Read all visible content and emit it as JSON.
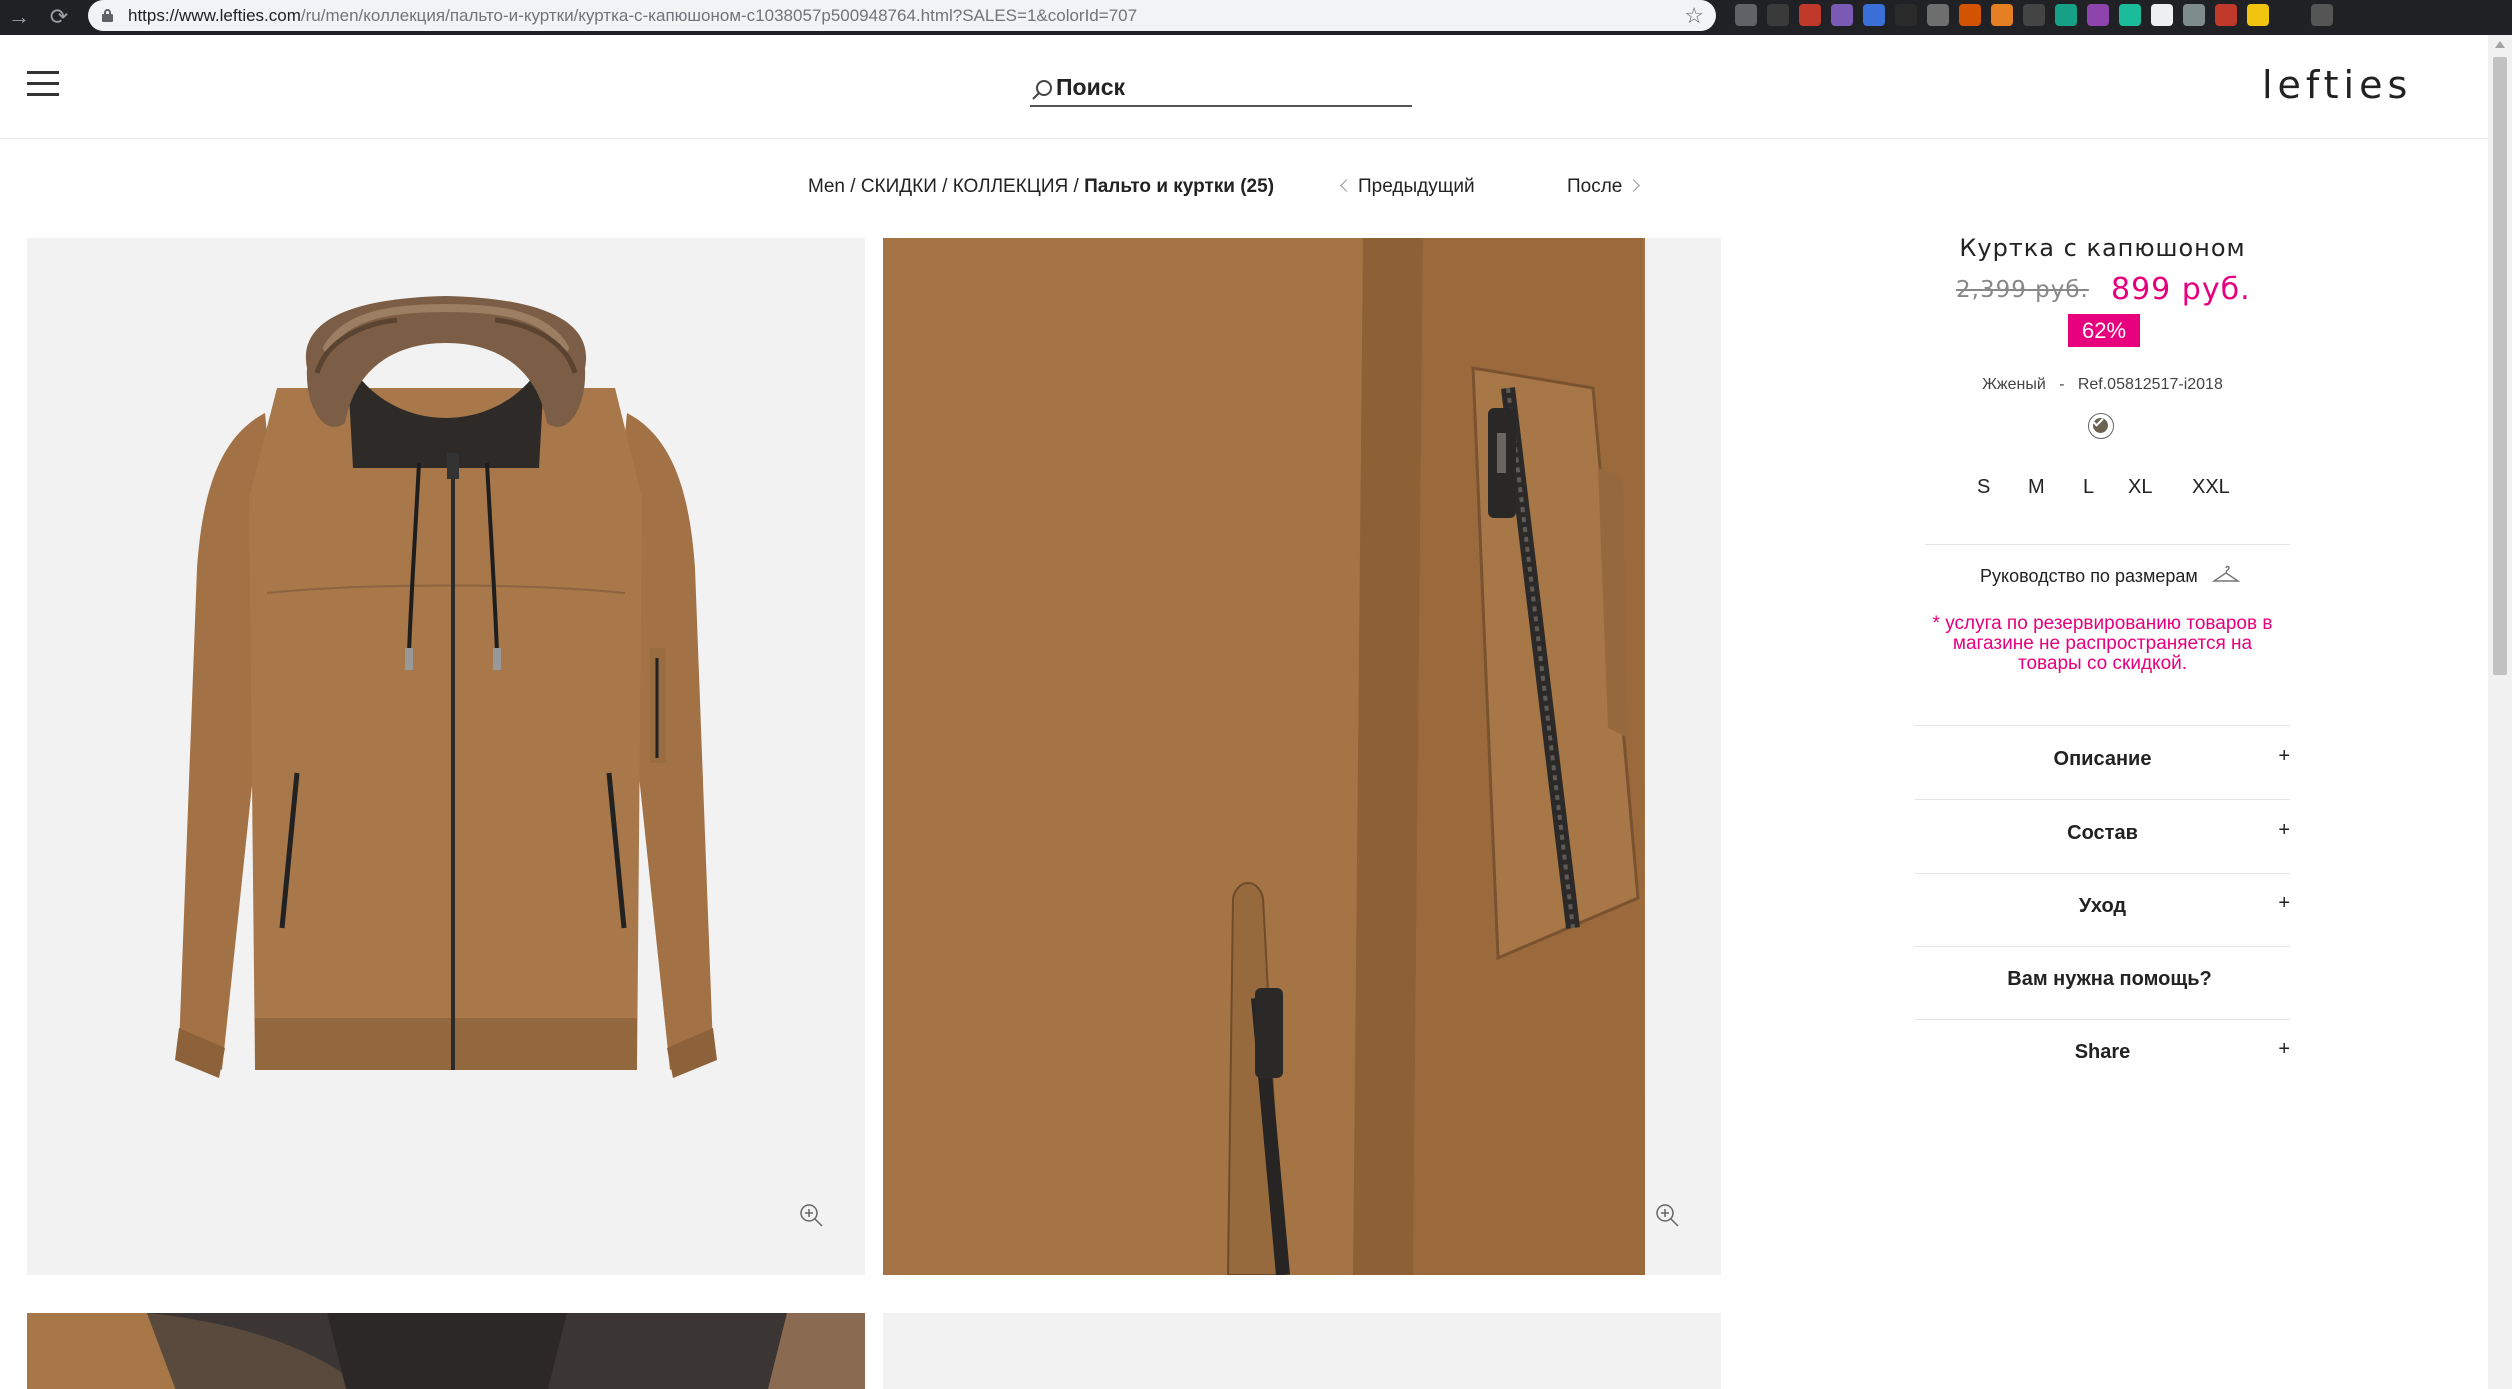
{
  "browser": {
    "url_domain": "https://www.lefties.com",
    "url_path": "/ru/men/коллекция/пальто-и-куртки/куртка-с-капюшоном-c1038057p500948764.html?SALES=1&colorId=707"
  },
  "header": {
    "search_placeholder": "Поиск",
    "logo": "lefties"
  },
  "breadcrumb": {
    "items": [
      "Men",
      "СКИДКИ",
      "КОЛЛЕКЦИЯ"
    ],
    "separator": " / ",
    "current": "Пальто и куртки (25)"
  },
  "pager": {
    "prev_label": "Предыдущий",
    "next_label": "После"
  },
  "product": {
    "title": "Куртка с капюшоном",
    "price_old": "2,399 руб.",
    "price_new": "899 руб.",
    "discount": "62%",
    "color_name": "Жженый",
    "ref_separator": "-",
    "ref": "Ref.05812517-i2018",
    "swatch_color": "#6b6350",
    "sizes": [
      "S",
      "M",
      "L",
      "XL",
      "XXL"
    ],
    "size_guide_label": "Руководство по размерам",
    "notice_lines": [
      "* услуга по резервированию товаров в",
      "магазине не распространяется на",
      "товары со скидкой."
    ]
  },
  "accordion": [
    {
      "label": "Описание",
      "plus": "+"
    },
    {
      "label": "Состав",
      "plus": "+"
    },
    {
      "label": "Уход",
      "plus": "+"
    },
    {
      "label": "Вам нужна помощь?",
      "plus": ""
    },
    {
      "label": "Share",
      "plus": "+"
    }
  ],
  "colors": {
    "accent": "#e6007e",
    "jacket": "#a57444"
  }
}
